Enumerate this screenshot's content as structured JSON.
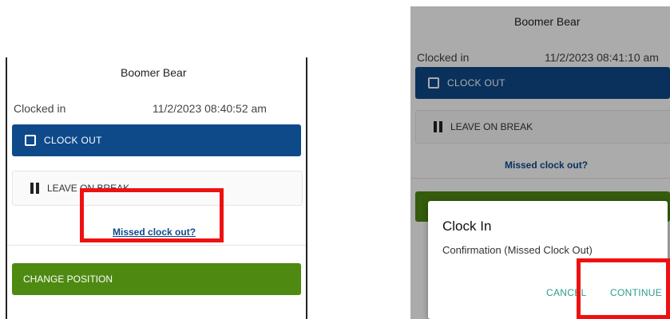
{
  "left_panel": {
    "user_name": "Boomer Bear",
    "status_label": "Clocked in",
    "status_time": "11/2/2023 08:40:52 am",
    "clock_out_label": "CLOCK OUT",
    "leave_break_label": "LEAVE ON BREAK",
    "missed_clock_out_label": "Missed clock out?",
    "change_position_label": "CHANGE POSITION"
  },
  "right_panel": {
    "user_name": "Boomer Bear",
    "status_label": "Clocked in",
    "status_time": "11/2/2023 08:41:10 am",
    "clock_out_label": "CLOCK OUT",
    "leave_break_label": "LEAVE ON BREAK",
    "missed_clock_out_label": "Missed clock out?",
    "dialog": {
      "title": "Clock In",
      "message": "Confirmation (Missed Clock Out)",
      "cancel_label": "CANCEL",
      "continue_label": "CONTINUE"
    }
  },
  "colors": {
    "primary_blue": "#0e4a8a",
    "change_green": "#4e8a12",
    "highlight_red": "#ee1111",
    "dialog_action_teal": "#2a9d8f"
  },
  "icons": [
    "checkbox-icon",
    "pause-icon"
  ]
}
